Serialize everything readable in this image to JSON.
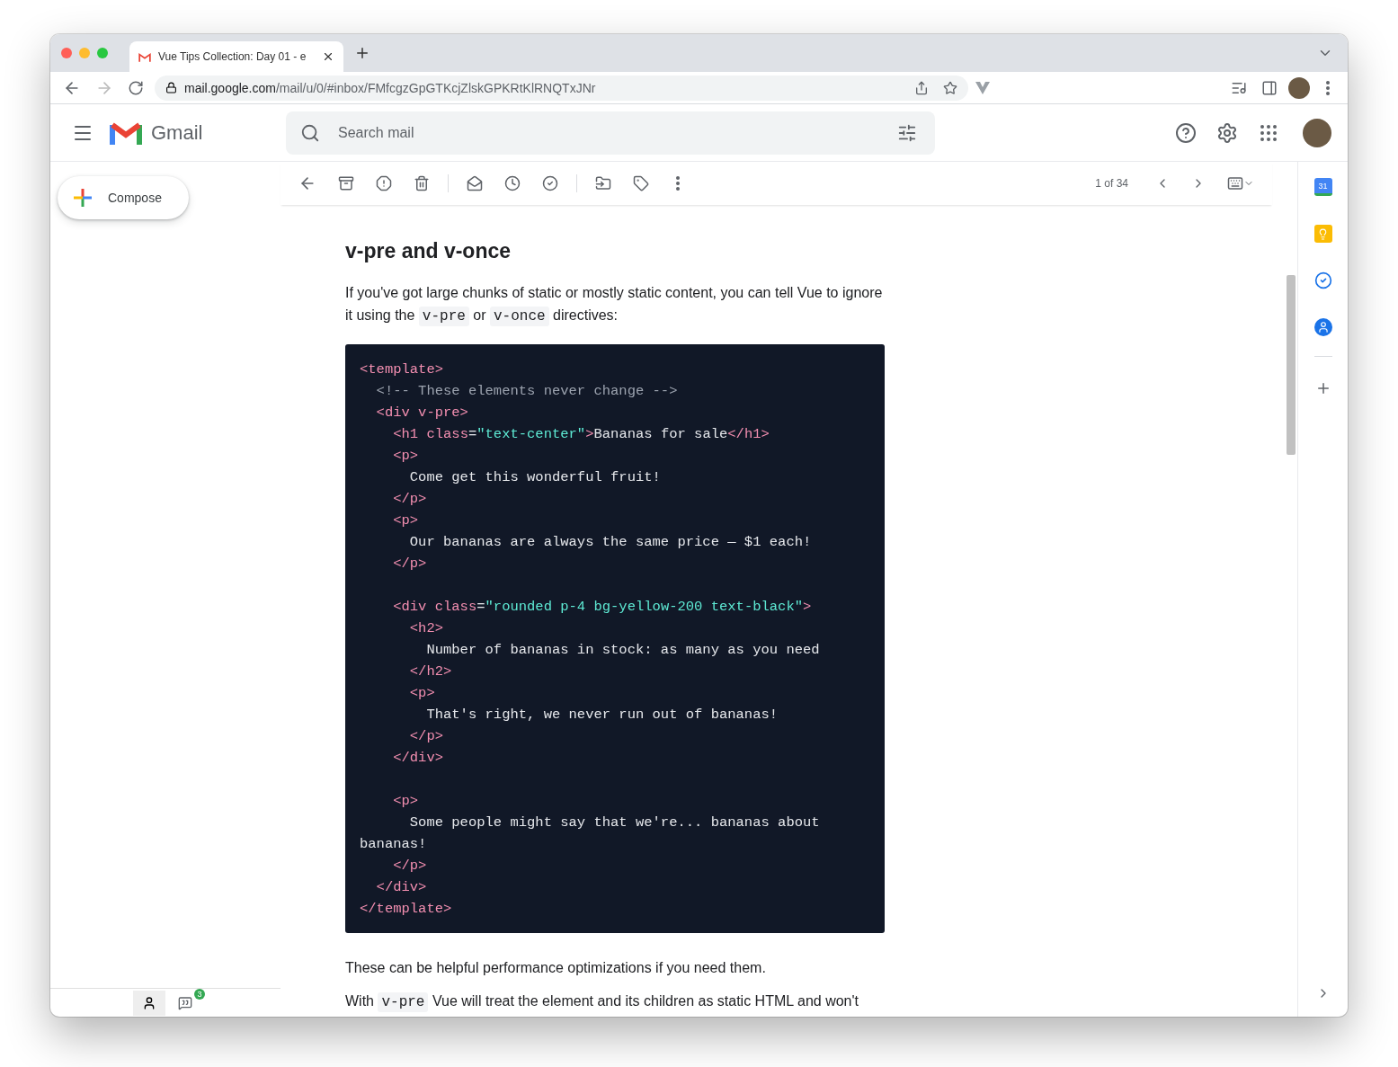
{
  "browser": {
    "tab": {
      "title": "Vue Tips Collection: Day 01 - e",
      "selected": true
    },
    "url_host": "mail.google.com",
    "url_path": "/mail/u/0/#inbox/FMfcgzGpGTKcjZlskGPKRtKlRNQTxJNr"
  },
  "header": {
    "product": "Gmail",
    "search": {
      "placeholder": "Search mail"
    }
  },
  "sidebar": {
    "compose": "Compose",
    "chat_badge": "3"
  },
  "toolbar": {
    "pager": "1 of 34"
  },
  "message": {
    "heading": "v-pre and v-once",
    "intro": [
      {
        "kind": "text",
        "text": "If you've got large chunks of static or mostly static content, you can tell Vue to ignore it using the "
      },
      {
        "kind": "code",
        "text": "v-pre"
      },
      {
        "kind": "text",
        "text": " or "
      },
      {
        "kind": "code",
        "text": "v-once"
      },
      {
        "kind": "text",
        "text": " directives:"
      }
    ],
    "code": [
      {
        "kind": "code",
        "tokens": [
          {
            "kind": "tag",
            "text": "<template>"
          }
        ]
      },
      {
        "kind": "code",
        "tokens": [
          {
            "kind": "comment",
            "text": "  <!-- These elements never change -->"
          }
        ]
      },
      {
        "kind": "code",
        "tokens": [
          {
            "kind": "tag",
            "text": "  <div v-pre>"
          }
        ]
      },
      {
        "kind": "code",
        "tokens": [
          {
            "kind": "tag",
            "text": "    <h1 "
          },
          {
            "kind": "attr",
            "text": "class"
          },
          {
            "kind": "text",
            "text": "="
          },
          {
            "kind": "string",
            "text": "\"text-center\""
          },
          {
            "kind": "tag",
            "text": ">"
          },
          {
            "kind": "text",
            "text": "Bananas for sale"
          },
          {
            "kind": "tag",
            "text": "</h1>"
          }
        ]
      },
      {
        "kind": "code",
        "tokens": [
          {
            "kind": "tag",
            "text": "    <p>"
          }
        ]
      },
      {
        "kind": "code",
        "tokens": [
          {
            "kind": "text",
            "text": "      Come get this wonderful fruit!"
          }
        ]
      },
      {
        "kind": "code",
        "tokens": [
          {
            "kind": "tag",
            "text": "    </p>"
          }
        ]
      },
      {
        "kind": "code",
        "tokens": [
          {
            "kind": "tag",
            "text": "    <p>"
          }
        ]
      },
      {
        "kind": "code",
        "tokens": [
          {
            "kind": "text",
            "text": "      Our bananas are always the same price — $1 each!"
          }
        ]
      },
      {
        "kind": "code",
        "tokens": [
          {
            "kind": "tag",
            "text": "    </p>"
          }
        ]
      },
      {
        "kind": "blank"
      },
      {
        "kind": "code",
        "tokens": [
          {
            "kind": "tag",
            "text": "    <div "
          },
          {
            "kind": "attr",
            "text": "class"
          },
          {
            "kind": "text",
            "text": "="
          },
          {
            "kind": "string",
            "text": "\"rounded p-4 bg-yellow-200 text-black\""
          },
          {
            "kind": "tag",
            "text": ">"
          }
        ]
      },
      {
        "kind": "code",
        "tokens": [
          {
            "kind": "tag",
            "text": "      <h2>"
          }
        ]
      },
      {
        "kind": "code",
        "tokens": [
          {
            "kind": "text",
            "text": "        Number of bananas in stock: as many as you need"
          }
        ]
      },
      {
        "kind": "code",
        "tokens": [
          {
            "kind": "tag",
            "text": "      </h2>"
          }
        ]
      },
      {
        "kind": "code",
        "tokens": [
          {
            "kind": "tag",
            "text": "      <p>"
          }
        ]
      },
      {
        "kind": "code",
        "tokens": [
          {
            "kind": "text",
            "text": "        That's right, we never run out of bananas!"
          }
        ]
      },
      {
        "kind": "code",
        "tokens": [
          {
            "kind": "tag",
            "text": "      </p>"
          }
        ]
      },
      {
        "kind": "code",
        "tokens": [
          {
            "kind": "tag",
            "text": "    </div>"
          }
        ]
      },
      {
        "kind": "blank"
      },
      {
        "kind": "code",
        "tokens": [
          {
            "kind": "tag",
            "text": "    <p>"
          }
        ]
      },
      {
        "kind": "code",
        "tokens": [
          {
            "kind": "text",
            "text": "      Some people might say that we're... bananas about"
          }
        ]
      },
      {
        "kind": "code",
        "tokens": [
          {
            "kind": "text",
            "text": "bananas!"
          }
        ]
      },
      {
        "kind": "code",
        "tokens": [
          {
            "kind": "tag",
            "text": "    </p>"
          }
        ]
      },
      {
        "kind": "code",
        "tokens": [
          {
            "kind": "tag",
            "text": "  </div>"
          }
        ]
      },
      {
        "kind": "code",
        "tokens": [
          {
            "kind": "tag",
            "text": "</template>"
          }
        ]
      }
    ],
    "after": [
      {
        "kind": "text",
        "text": "These can be helpful performance optimizations if you need them."
      }
    ],
    "cut_line": [
      {
        "kind": "text",
        "text": "With "
      },
      {
        "kind": "code",
        "text": "v-pre"
      },
      {
        "kind": "text",
        "text": " Vue will treat the element and its children as static HTML and won't"
      }
    ]
  },
  "side_panel": {
    "calendar_day": "31"
  }
}
